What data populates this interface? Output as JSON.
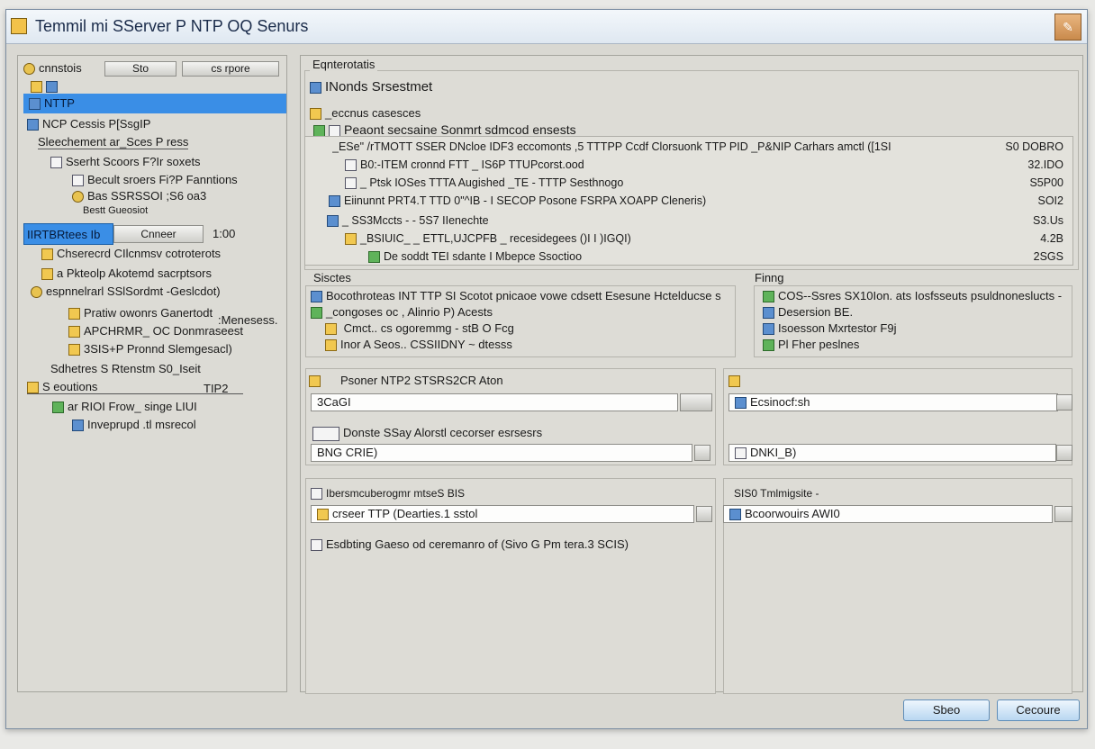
{
  "window": {
    "title": "Temmil mi SServer P NTP OQ Senurs",
    "close_glyph": "✎"
  },
  "left": {
    "top_label": "cnnstois",
    "top_btn1": "Sto",
    "top_btn2_prefix": "cs",
    "top_btn2": "rpore",
    "tree": [
      {
        "label": "NTTP",
        "selected": true
      },
      {
        "label": "NCP Cessis  P[SsgIP"
      },
      {
        "label": "Sleechement  ar_Sces  P ress"
      },
      {
        "label": "Sserht  Scoors  F?Ir soxets"
      },
      {
        "label": "Becult  sroers  Fi?P Fanntions"
      },
      {
        "label": "Bas  SSRSSOI  ;S6  oa3"
      },
      {
        "label": "Bestt  Gueosiot"
      },
      {
        "label": "Chserecrd  CIlcnmsv  cotroterots"
      },
      {
        "label": "a Pkteolp  Akotemd  sacrptsors"
      },
      {
        "label": "espnnelrarl  SSlSordmt  -Geslcdot)"
      },
      {
        "label": "Pratiw owonrs  Ganertodt"
      },
      {
        "label": "APCHRMR_  OC  Donmraseest"
      },
      {
        "label": "3SIS+P  Pronnd  Slemgesacl)"
      },
      {
        "label": "Sdhetres  S  Rtenstm  S0_Iseit"
      },
      {
        "label": "S  eoutions"
      },
      {
        "label": "ar  RIOI  Frow_  singe  LIUI"
      },
      {
        "label": "Inveprupd  .tl  msrecol"
      }
    ],
    "selected_row_left": "IIRTBRtees  Ib",
    "selected_row_input": "Cnneer",
    "selected_row_value": "1:00",
    "side_note": ":Menesess.",
    "side_tag": "TIP2"
  },
  "right": {
    "group1_label": "Eqnterotatis",
    "network_label": "INonds  Srsestmet",
    "sub_label": "_eccnus  casesces",
    "section_header": "Peaont  secsaine  Sonmrt  sdmcod ensests",
    "table_rows": [
      {
        "text": "_ESe\"  /rTMOTT  SSER  DNcloe  IDF3  eccomonts  ,5 TTTPP  Ccdf Clorsuonk  TTP PID  _P&NIP Carhars   amctl  ([1SI",
        "value": "S0 DOBRO"
      },
      {
        "text": "B0:-ITEM  cronnd  FTT _  IS6P  TTUPcorst.ood",
        "value": "32.IDO"
      },
      {
        "text": "_  Ptsk  IOSes  TTTA  Augished  _TE  -  TTTP  Sesthnogo",
        "value": "S5P00"
      },
      {
        "text": "Eiinunnt  PRT4.T  TTD  0\"^IB  -  I  SECOP  Posone  FSRPA  XOAPP Cleneris)",
        "value": "SOI2"
      },
      {
        "text": "_ SS3Mccts  -  -  5S7  IIenechte",
        "value": "S3.Us"
      },
      {
        "text": "_BSIUIC_  _ ETTL,UJCPFB  _  recesidegees  ()I  I  )IGQI)",
        "value": "4.2B"
      },
      {
        "text": "De  soddt  TEI  sdante  I  Mbepce  Ssoctioo",
        "value": "2SGS"
      }
    ],
    "sites_label": "Sisctes",
    "sites_rows": [
      "Bocothroteas  INT TTP  SI  Scotot  pnicaoe  vowe cdsett  Esesune  Hctelducse  s",
      "_congoses oc  ,  Alinrio  P)  Acests",
      "  Cmct.. cs  ogoremmg  - stB  O  Fcg",
      "Inor  A  Seos..  CSSIIDNY  ~  dtesss"
    ],
    "pinng_label": "Finng",
    "pinng_rows": [
      "COS--Ssres   SX10Ion.  ats  Iosfsseuts  psuldnoneslucts  -",
      "Desersion  BE.",
      "Isoesson  Mxrtestor  F9j",
      "Pl  Fher  peslnes"
    ],
    "server_label": "Psoner  NTP2  STSRS2CR  Aton",
    "server_input1": "3CaGI",
    "server_sub": "Donste  SSay  Alorstl  cecorser  esrsesrs",
    "server_input2": "BNG  CRIE)",
    "right_input1": "Ecsinocf:sh",
    "right_input2": "DNKI_B)",
    "lower_left_label": "Ibersmcuberogmr  mtseS BIS",
    "lower_left_input": "crseer  TTP  (Dearties.1  sstol",
    "lower_left_check": "Esdbting  Gaeso  od  ceremanro  of  (Sivo  G  Pm  tera.3  SCIS)",
    "lower_right_label": "SIS0  Tmlmigsite  -",
    "lower_right_input": "Bcoorwouirs  AWI0"
  },
  "footer": {
    "ok": "Sbeo",
    "cancel": "Cecoure"
  }
}
